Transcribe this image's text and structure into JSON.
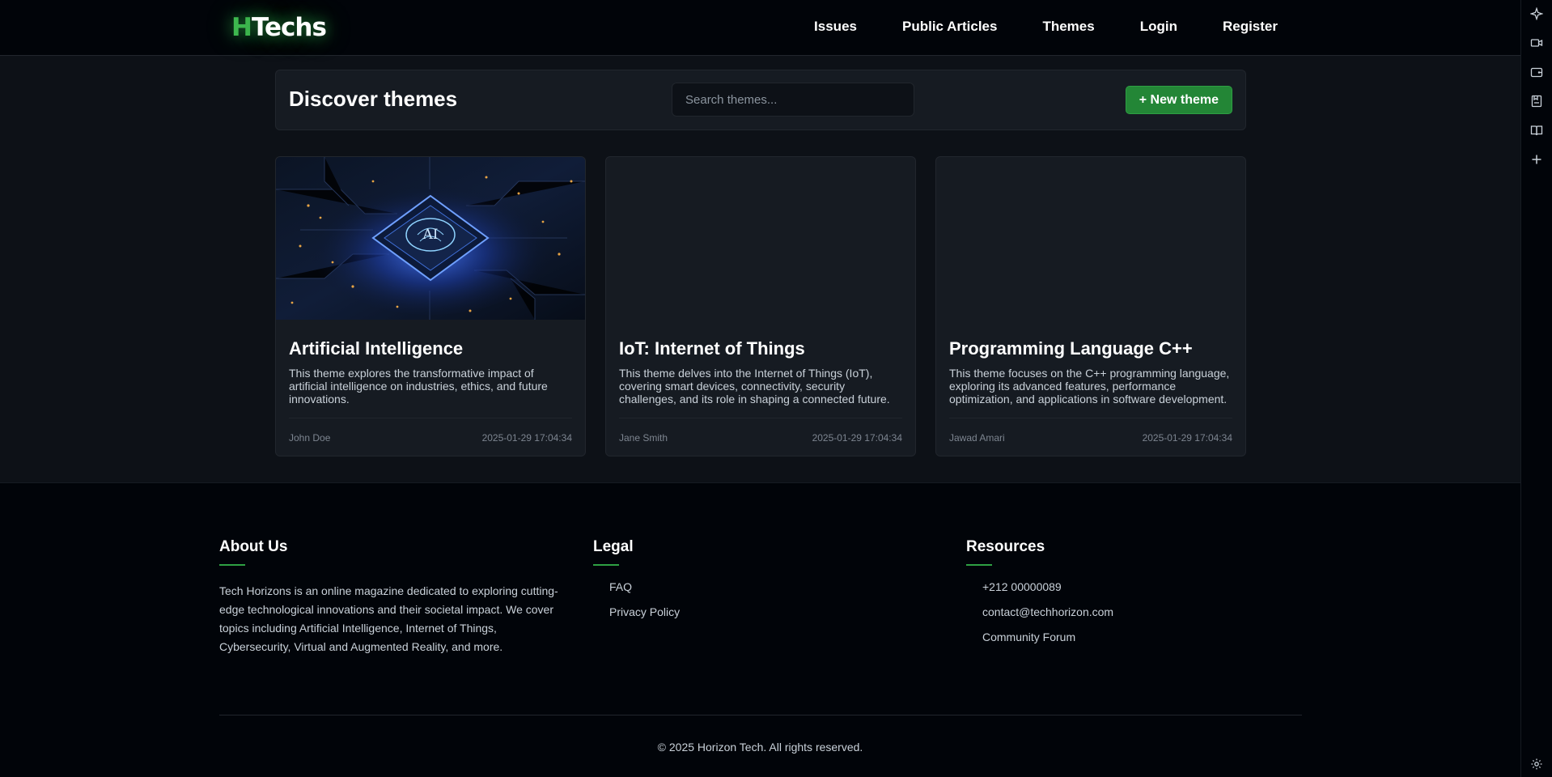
{
  "header": {
    "logo_initial": "H",
    "logo_rest": "Techs",
    "nav": [
      "Issues",
      "Public Articles",
      "Themes",
      "Login",
      "Register"
    ]
  },
  "discover": {
    "title": "Discover themes",
    "search_placeholder": "Search themes...",
    "new_button": "+ New theme"
  },
  "cards": [
    {
      "title": "Artificial Intelligence",
      "description": "This theme explores the transformative impact of artificial intelligence on industries, ethics, and future innovations.",
      "author": "John Doe",
      "date": "2025-01-29 17:04:34",
      "image_text": "AI"
    },
    {
      "title": "IoT: Internet of Things",
      "description": "This theme delves into the Internet of Things (IoT), covering smart devices, connectivity, security challenges, and its role in shaping a connected future.",
      "author": "Jane Smith",
      "date": "2025-01-29 17:04:34"
    },
    {
      "title": "Programming Language C++",
      "description": "This theme focuses on the C++ programming language, exploring its advanced features, performance optimization, and applications in software development.",
      "author": "Jawad Amari",
      "date": "2025-01-29 17:04:34"
    }
  ],
  "footer": {
    "about": {
      "title": "About Us",
      "text": "Tech Horizons is an online magazine dedicated to exploring cutting-edge technological innovations and their societal impact. We cover topics including Artificial Intelligence, Internet of Things, Cybersecurity, Virtual and Augmented Reality, and more."
    },
    "legal": {
      "title": "Legal",
      "items": [
        "FAQ",
        "Privacy Policy"
      ]
    },
    "resources": {
      "title": "Resources",
      "items": [
        "+212 00000089",
        "contact@techhorizon.com",
        "Community Forum"
      ]
    },
    "copyright": "© 2025 Horizon Tech. All rights reserved."
  },
  "sidebar_icons": [
    "sparkle-icon",
    "video-icon",
    "wallet-icon",
    "bookmark-icon",
    "book-icon",
    "plus-icon",
    "settings-icon"
  ],
  "colors": {
    "background": "#0d1117",
    "header": "#010409",
    "accent_green": "#238636",
    "logo_green": "#3fb950"
  }
}
